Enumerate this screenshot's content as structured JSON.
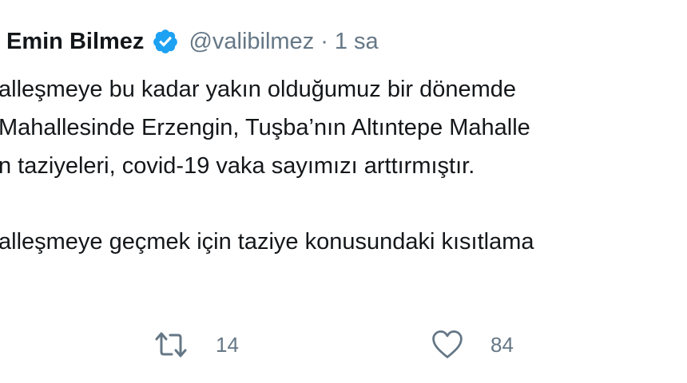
{
  "tweet": {
    "display_name": "Emin Bilmez",
    "handle": "@valibilmez",
    "separator": "·",
    "time": "1 sa",
    "lines": [
      "alleşmeye bu kadar yakın olduğumuz bir dönemde",
      "Mahallesinde Erzengin, Tuşba’nın Altıntepe Mahalle",
      "n taziyeleri, covid-19 vaka sayımızı arttırmıştır.",
      "alleşmeye geçmek için taziye konusundaki kısıtlama"
    ],
    "retweet_count": "14",
    "like_count": "84"
  },
  "colors": {
    "verified": "#1da1f2",
    "muted": "#657786",
    "text": "#14171a"
  },
  "icons": {
    "verified": "verified-badge-icon",
    "retweet": "retweet-icon",
    "like": "heart-icon"
  }
}
